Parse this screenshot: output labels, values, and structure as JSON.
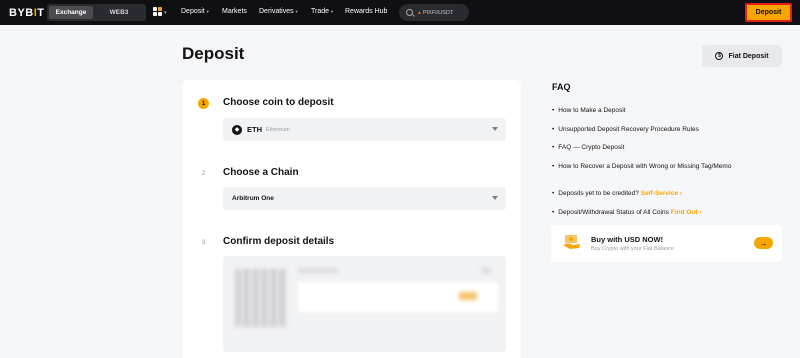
{
  "nav": {
    "logo": "BYBIT",
    "tabs": [
      "Exchange",
      "WEB3"
    ],
    "links": [
      {
        "label": "Deposit",
        "dropdown": true
      },
      {
        "label": "Markets",
        "dropdown": false
      },
      {
        "label": "Derivatives",
        "dropdown": true
      },
      {
        "label": "Trade",
        "dropdown": true
      },
      {
        "label": "Rewards Hub",
        "dropdown": false
      }
    ],
    "search_value": "PIXFI/USDT",
    "deposit_button": "Deposit"
  },
  "page": {
    "title": "Deposit",
    "fiat_button": "Fiat Deposit"
  },
  "steps": [
    {
      "number": "1",
      "title": "Choose coin to deposit"
    },
    {
      "number": "2",
      "title": "Choose a Chain"
    },
    {
      "number": "3",
      "title": "Confirm deposit details"
    }
  ],
  "coin_select": {
    "symbol": "ETH",
    "name": "Ethereum"
  },
  "chain_select": {
    "value": "Arbitrum One"
  },
  "faq": {
    "title": "FAQ",
    "items": [
      "How to Make a Deposit",
      "Unsupported Deposit Recovery Procedure Rules",
      "FAQ — Crypto Deposit",
      "How to Recover a Deposit with Wrong or Missing Tag/Memo"
    ],
    "status_items": [
      {
        "text": "Deposits yet to be credited?",
        "link": "Self-Service"
      },
      {
        "text": "Deposit/Withdrawal Status of All Coins",
        "link": "Find Out"
      }
    ]
  },
  "promo": {
    "title": "Buy with USD NOW!",
    "subtitle": "Buy Crypto with your Fiat Balance"
  },
  "colors": {
    "accent": "#f7a600",
    "nav_bg": "#101014",
    "highlight": "#e02020"
  }
}
